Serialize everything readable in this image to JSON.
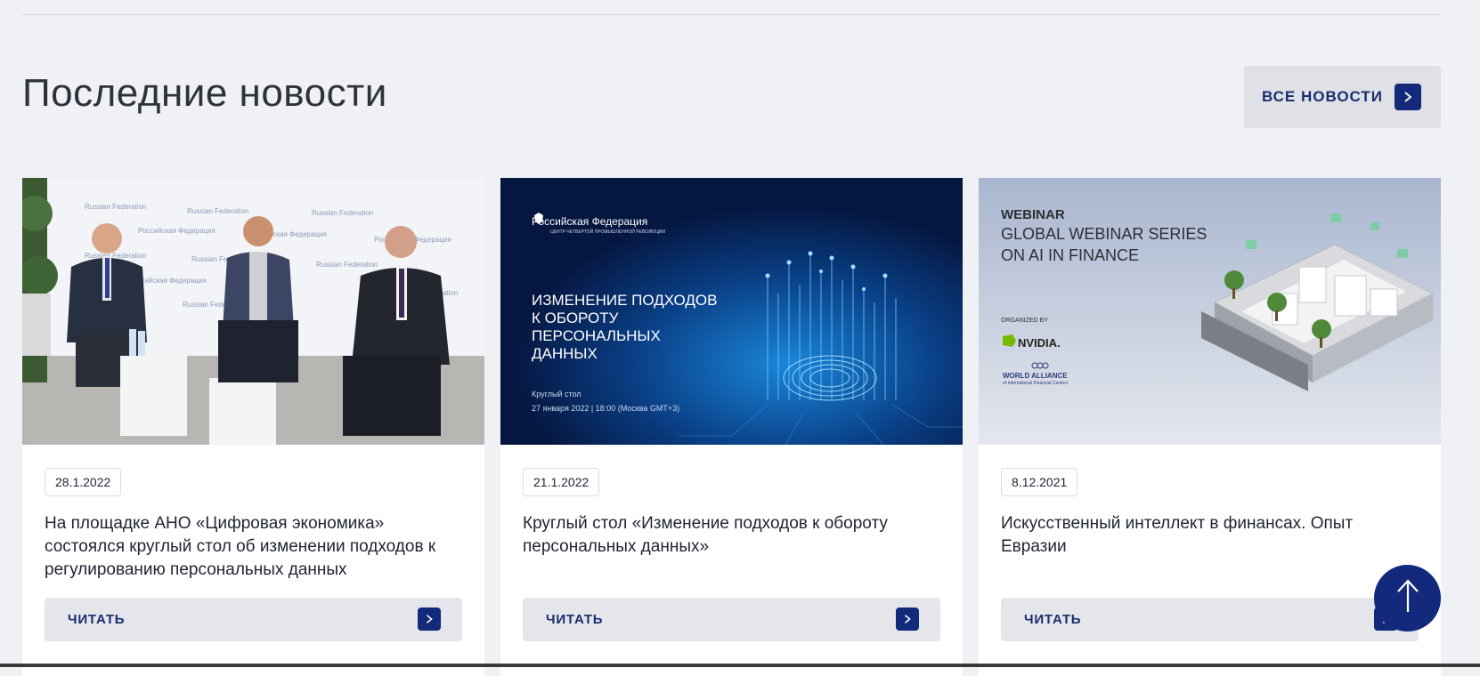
{
  "section": {
    "title": "Последние новости",
    "all_news_label": "ВСЕ НОВОСТИ"
  },
  "cards": [
    {
      "date": "28.1.2022",
      "title": "На площадке АНО «Цифровая экономика» состоялся круглый стол об изменении подходов к регулированию персональных данных",
      "read_label": "ЧИТАТЬ",
      "image": {
        "backdrop_text": "Russian Federation",
        "backdrop_text_ru": "Российская Федерация"
      }
    },
    {
      "date": "21.1.2022",
      "title": "Круглый стол «Изменение подходов к обороту персональных данных»",
      "read_label": "ЧИТАТЬ",
      "image": {
        "org": "Российская Федерация",
        "org_sub": "ЦЕНТР ЧЕТВЕРТОЙ ПРОМЫШЛЕННОЙ РЕВОЛЮЦИИ",
        "headline_1": "ИЗМЕНЕНИЕ ПОДХОДОВ",
        "headline_2": "К ОБОРОТУ",
        "headline_3": "ПЕРСОНАЛЬНЫХ",
        "headline_4": "ДАННЫХ",
        "event_type": "Круглый стол",
        "event_time": "27 января 2022 | 18:00 (Москва GMT+3)"
      }
    },
    {
      "date": "8.12.2021",
      "title": "Искусственный интеллект в финансах. Опыт Евразии",
      "read_label": "ЧИТАТЬ",
      "image": {
        "kicker": "WEBINAR",
        "headline_1": "GLOBAL WEBINAR SERIES",
        "headline_2": "ON AI IN FINANCE",
        "organized_by": "ORGANIZED BY",
        "sponsor_1": "NVIDIA.",
        "sponsor_2": "WORLD ALLIANCE",
        "sponsor_2_sub": "of International Financial Centers"
      }
    }
  ],
  "colors": {
    "accent": "#13297a",
    "page_bg": "#f0f1f5",
    "button_bg": "#e4e6ec"
  },
  "icons": {
    "arrow": "chevron-right-icon",
    "scroll_top": "arrow-up-icon"
  }
}
